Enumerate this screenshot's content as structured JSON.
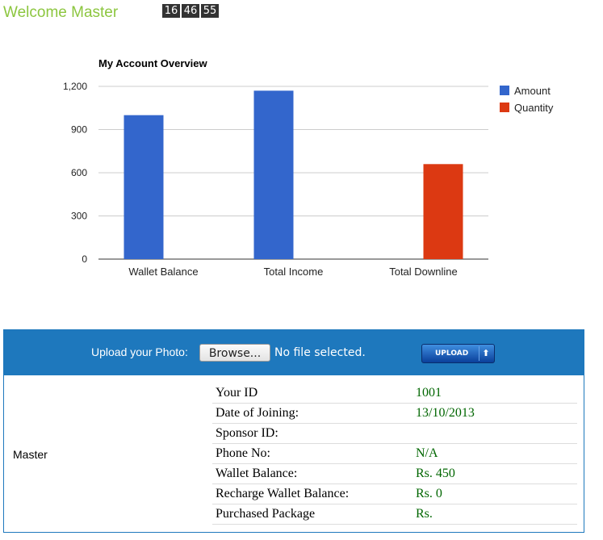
{
  "header": {
    "welcome": "Welcome Master",
    "clock": [
      "16",
      "46",
      "55"
    ]
  },
  "chart_data": {
    "type": "bar",
    "title": "My Account Overview",
    "categories": [
      "Wallet Balance",
      "Total Income",
      "Total Downline"
    ],
    "series": [
      {
        "name": "Amount",
        "color": "#3366cc",
        "values": [
          1000,
          1170,
          0
        ]
      },
      {
        "name": "Quantity",
        "color": "#dc3912",
        "values": [
          0,
          0,
          660
        ]
      }
    ],
    "ylim": [
      0,
      1200
    ],
    "yticks": [
      0,
      300,
      600,
      900,
      1200
    ],
    "ytick_labels": [
      "0",
      "300",
      "600",
      "900",
      "1,200"
    ],
    "legend": "right",
    "grid": true
  },
  "upload": {
    "label": "Upload your Photo:",
    "browse": "Browse...",
    "no_file": "No file selected.",
    "button": "UPLOAD"
  },
  "profile": {
    "username": "Master",
    "rows": [
      {
        "label": "Your ID",
        "value": "1001"
      },
      {
        "label": "Date of Joining:",
        "value": "13/10/2013"
      },
      {
        "label": "Sponsor ID:",
        "value": ""
      },
      {
        "label": "Phone No:",
        "value": "N/A"
      },
      {
        "label": "Wallet Balance:",
        "value": "Rs. 450"
      },
      {
        "label": "Recharge Wallet Balance:",
        "value": "Rs. 0"
      },
      {
        "label": "Purchased Package",
        "value": "Rs."
      }
    ]
  }
}
